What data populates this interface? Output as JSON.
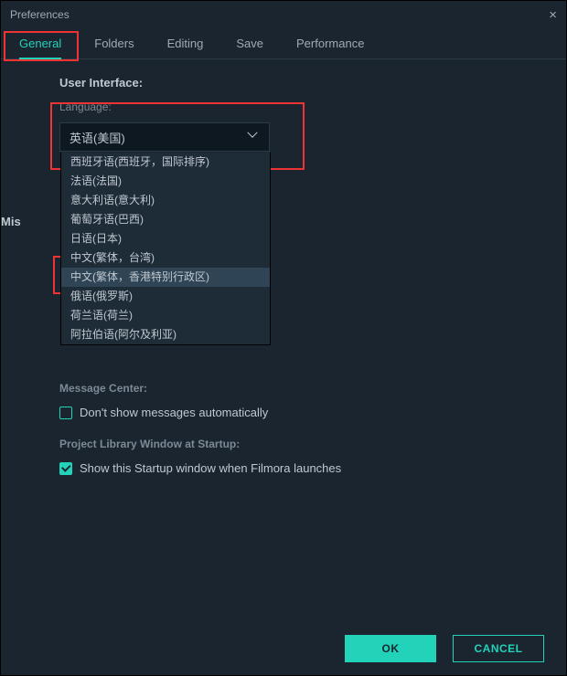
{
  "window": {
    "title": "Preferences",
    "close_glyph": "×"
  },
  "tabs": {
    "general": "General",
    "folders": "Folders",
    "editing": "Editing",
    "save": "Save",
    "performance": "Performance"
  },
  "ui_section": {
    "heading": "User Interface:",
    "language_label": "Language:",
    "language_selected": "英语(美国)",
    "options": [
      {
        "label": "西班牙语(西班牙，国际排序)",
        "hl": false
      },
      {
        "label": "法语(法国)",
        "hl": false
      },
      {
        "label": "意大利语(意大利)",
        "hl": false
      },
      {
        "label": "葡萄牙语(巴西)",
        "hl": false
      },
      {
        "label": "日语(日本)",
        "hl": false
      },
      {
        "label": "中文(繁体，台湾)",
        "hl": false
      },
      {
        "label": "中文(繁体，香港特别行政区)",
        "hl": true
      },
      {
        "label": "俄语(俄罗斯)",
        "hl": false
      },
      {
        "label": "荷兰语(荷兰)",
        "hl": false
      },
      {
        "label": "阿拉伯语(阿尔及利亚)",
        "hl": false
      }
    ]
  },
  "misc_section": {
    "heading_partial": "Mis",
    "message_center_label": "Message Center:",
    "dont_show_label": "Don't show messages automatically",
    "dont_show_checked": false,
    "plw_label": "Project Library Window at Startup:",
    "show_startup_label": "Show this Startup window when Filmora launches",
    "show_startup_checked": true
  },
  "footer": {
    "ok": "OK",
    "cancel": "CANCEL"
  }
}
